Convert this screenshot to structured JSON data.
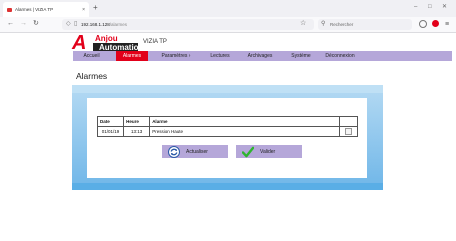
{
  "browser": {
    "tab_title": "Alarmes | VIZIA TP",
    "tab_close": "×",
    "new_tab": "+",
    "url_host": "192.168.1.128",
    "url_path": "/alarmes",
    "search_placeholder": "Rechercher"
  },
  "app": {
    "logo_top": "Anjou",
    "logo_bottom": "Automation",
    "title": "VIZIA TP"
  },
  "menu": {
    "items": [
      "Accueil",
      "Alarmes",
      "Paramètres ›",
      "Lectures",
      "Archivages",
      "Système",
      "Déconnexion"
    ]
  },
  "page": {
    "title": "Alarmes"
  },
  "alarms_table": {
    "headers": [
      "Date",
      "Heure",
      "Alarme",
      ""
    ],
    "rows": [
      {
        "date": "01/01/19",
        "heure": "13:13",
        "alarme": "Pression Haute"
      }
    ]
  },
  "buttons": {
    "refresh_label": "Actualiser",
    "validate_label": "Valider"
  },
  "colors": {
    "brand_red": "#e2001a",
    "menu_purple": "#b5a7d9",
    "panel_blue": "#6fb6e8"
  }
}
